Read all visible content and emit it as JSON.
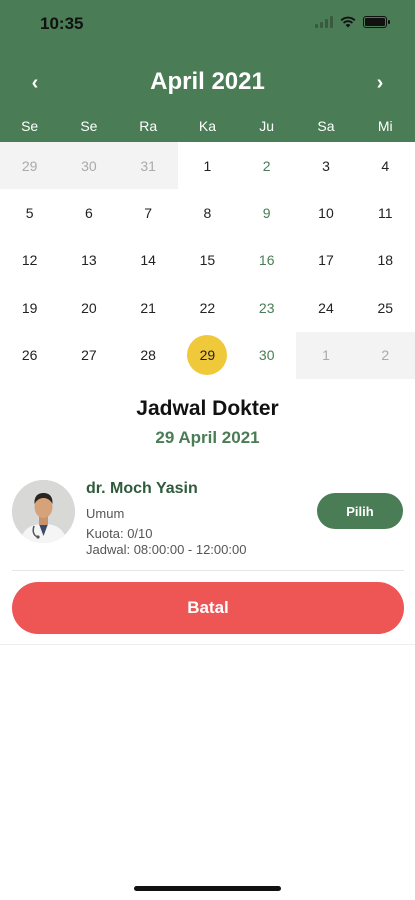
{
  "status_bar": {
    "time": "10:35"
  },
  "calendar": {
    "month_title": "April 2021",
    "prev_icon": "chevron-left-icon",
    "next_icon": "chevron-right-icon",
    "prev_glyph": "‹",
    "next_glyph": "›",
    "weekdays": [
      "Se",
      "Se",
      "Ra",
      "Ka",
      "Ju",
      "Sa",
      "Mi"
    ],
    "days": [
      {
        "label": "29",
        "state": "out"
      },
      {
        "label": "30",
        "state": "out"
      },
      {
        "label": "31",
        "state": "out"
      },
      {
        "label": "1",
        "state": ""
      },
      {
        "label": "2",
        "state": "green"
      },
      {
        "label": "3",
        "state": ""
      },
      {
        "label": "4",
        "state": ""
      },
      {
        "label": "5",
        "state": ""
      },
      {
        "label": "6",
        "state": ""
      },
      {
        "label": "7",
        "state": ""
      },
      {
        "label": "8",
        "state": ""
      },
      {
        "label": "9",
        "state": "green"
      },
      {
        "label": "10",
        "state": ""
      },
      {
        "label": "11",
        "state": ""
      },
      {
        "label": "12",
        "state": ""
      },
      {
        "label": "13",
        "state": ""
      },
      {
        "label": "14",
        "state": ""
      },
      {
        "label": "15",
        "state": ""
      },
      {
        "label": "16",
        "state": "green"
      },
      {
        "label": "17",
        "state": ""
      },
      {
        "label": "18",
        "state": ""
      },
      {
        "label": "19",
        "state": ""
      },
      {
        "label": "20",
        "state": ""
      },
      {
        "label": "21",
        "state": ""
      },
      {
        "label": "22",
        "state": ""
      },
      {
        "label": "23",
        "state": "green"
      },
      {
        "label": "24",
        "state": ""
      },
      {
        "label": "25",
        "state": ""
      },
      {
        "label": "26",
        "state": ""
      },
      {
        "label": "27",
        "state": ""
      },
      {
        "label": "28",
        "state": ""
      },
      {
        "label": "29",
        "state": "selected"
      },
      {
        "label": "30",
        "state": "green"
      },
      {
        "label": "1",
        "state": "out"
      },
      {
        "label": "2",
        "state": "out"
      }
    ]
  },
  "schedule": {
    "title": "Jadwal Dokter",
    "date": "29 April 2021"
  },
  "doctor": {
    "name": "dr. Moch Yasin",
    "specialty": "Umum",
    "quota": "Kuota: 0/10",
    "schedule": "Jadwal: 08:00:00 - 12:00:00",
    "pick_label": "Pilih"
  },
  "actions": {
    "cancel_label": "Batal"
  },
  "colors": {
    "primary": "#4a7c55",
    "selected_day": "#f0c93b",
    "cancel": "#ee5655"
  }
}
